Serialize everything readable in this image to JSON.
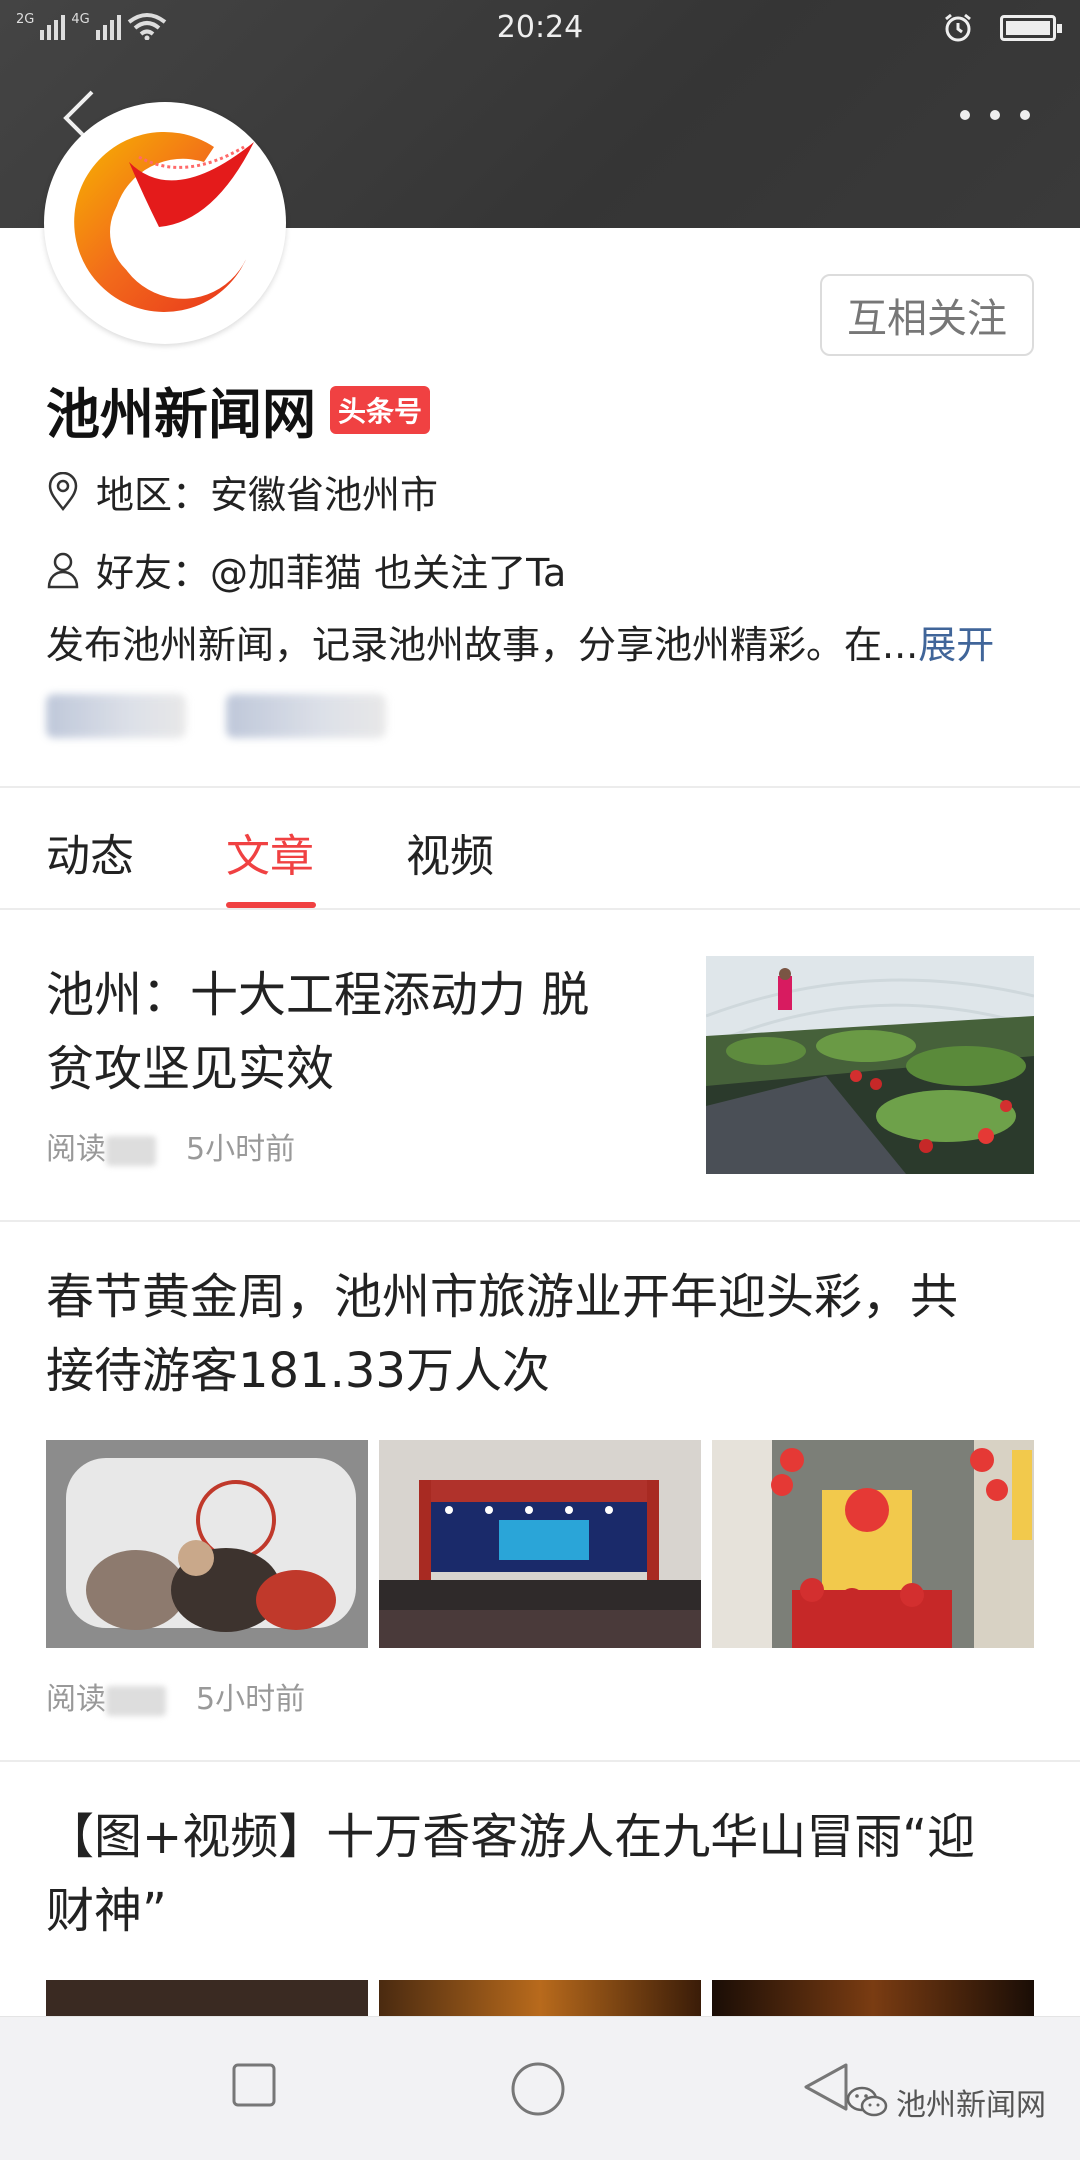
{
  "status": {
    "network_labels": [
      "2G",
      "4G"
    ],
    "time": "20:24"
  },
  "profile": {
    "name": "池州新闻网",
    "badge": "头条号",
    "follow_button": "互相关注",
    "region": "地区：安徽省池州市",
    "friends": "好友：@加菲猫 也关注了Ta",
    "description": "发布池州新闻，记录池州故事，分享池州精彩。在...",
    "expand_label": "展开"
  },
  "tabs": [
    "动态",
    "文章",
    "视频"
  ],
  "active_tab": "文章",
  "articles": [
    {
      "title_line1": "池州：十大工程添动力 脱",
      "title_line2": "贫攻坚见实效",
      "read_label": "阅读",
      "time": "5小时前"
    },
    {
      "title_line1": "春节黄金周，池州市旅游业开年迎头彩，共",
      "title_line2": "接待游客181.33万人次",
      "read_label": "阅读",
      "time": "5小时前"
    },
    {
      "title_line1": "【图+视频】十万香客游人在九华山冒雨“迎",
      "title_line2": "财神”"
    }
  ],
  "watermark": "池州新闻网",
  "colors": {
    "accent_red": "#f04142",
    "link_blue": "#406599",
    "header_dark": "#3b3b3b"
  },
  "icons": {
    "back": "chevron-left-icon",
    "more": "more-dots-icon",
    "location": "location-pin-icon",
    "friend": "person-icon",
    "alarm": "alarm-icon",
    "wifi": "wifi-icon",
    "battery": "battery-icon"
  }
}
